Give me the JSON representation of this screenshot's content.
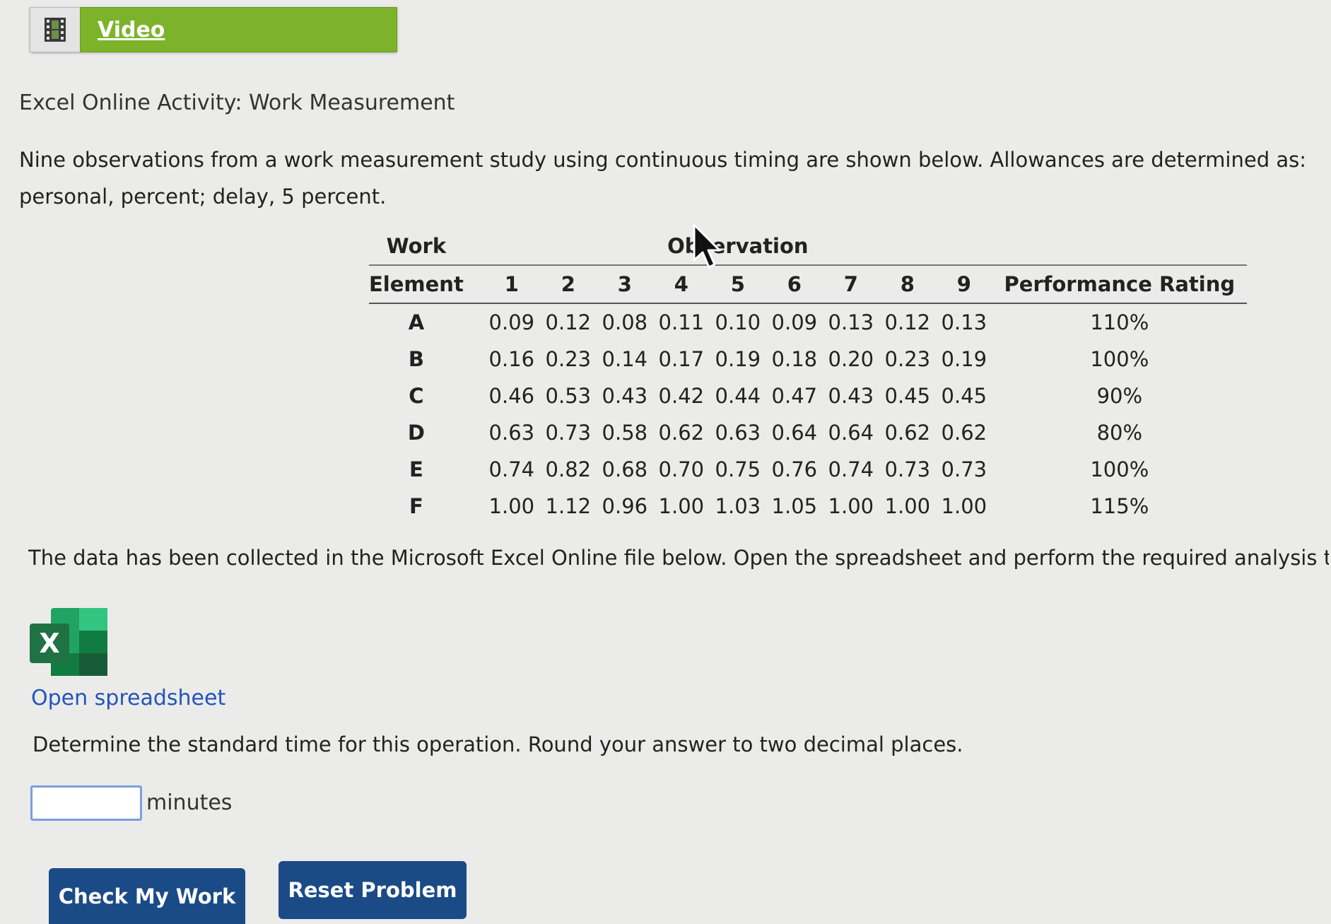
{
  "video": {
    "label": "Video",
    "icon": "film-icon"
  },
  "activity_title": "Excel Online Activity: Work Measurement",
  "intro_text": "Nine observations from a work measurement study using continuous timing are shown below. Allowances are determined as: personal, percent; delay, 5 percent.",
  "table": {
    "header_work": "Work",
    "header_observation": "Observation",
    "header_element": "Element",
    "header_performance": "Performance Rating",
    "observation_numbers": [
      "1",
      "2",
      "3",
      "4",
      "5",
      "6",
      "7",
      "8",
      "9"
    ],
    "rows": [
      {
        "element": "A",
        "values": [
          "0.09",
          "0.12",
          "0.08",
          "0.11",
          "0.10",
          "0.09",
          "0.13",
          "0.12",
          "0.13"
        ],
        "rating": "110%"
      },
      {
        "element": "B",
        "values": [
          "0.16",
          "0.23",
          "0.14",
          "0.17",
          "0.19",
          "0.18",
          "0.20",
          "0.23",
          "0.19"
        ],
        "rating": "100%"
      },
      {
        "element": "C",
        "values": [
          "0.46",
          "0.53",
          "0.43",
          "0.42",
          "0.44",
          "0.47",
          "0.43",
          "0.45",
          "0.45"
        ],
        "rating": "90%"
      },
      {
        "element": "D",
        "values": [
          "0.63",
          "0.73",
          "0.58",
          "0.62",
          "0.63",
          "0.64",
          "0.64",
          "0.62",
          "0.62"
        ],
        "rating": "80%"
      },
      {
        "element": "E",
        "values": [
          "0.74",
          "0.82",
          "0.68",
          "0.70",
          "0.75",
          "0.76",
          "0.74",
          "0.73",
          "0.73"
        ],
        "rating": "100%"
      },
      {
        "element": "F",
        "values": [
          "1.00",
          "1.12",
          "0.96",
          "1.00",
          "1.03",
          "1.05",
          "1.00",
          "1.00",
          "1.00"
        ],
        "rating": "115%"
      }
    ]
  },
  "data_note": "The data has been collected in the Microsoft Excel Online file below. Open the spreadsheet and perform the required analysis to answer",
  "excel_icon": {
    "name": "excel-icon",
    "letter": "X",
    "color": "#1f7244"
  },
  "open_spreadsheet_label": "Open spreadsheet",
  "question_text": "Determine the standard time for this operation. Round your answer to two decimal places.",
  "answer": {
    "value": "",
    "unit": "minutes"
  },
  "buttons": {
    "check": "Check My Work",
    "reset": "Reset Problem"
  },
  "colors": {
    "video_green": "#7cb32a",
    "button_blue": "#1b4b86",
    "link_blue": "#2455b8"
  }
}
